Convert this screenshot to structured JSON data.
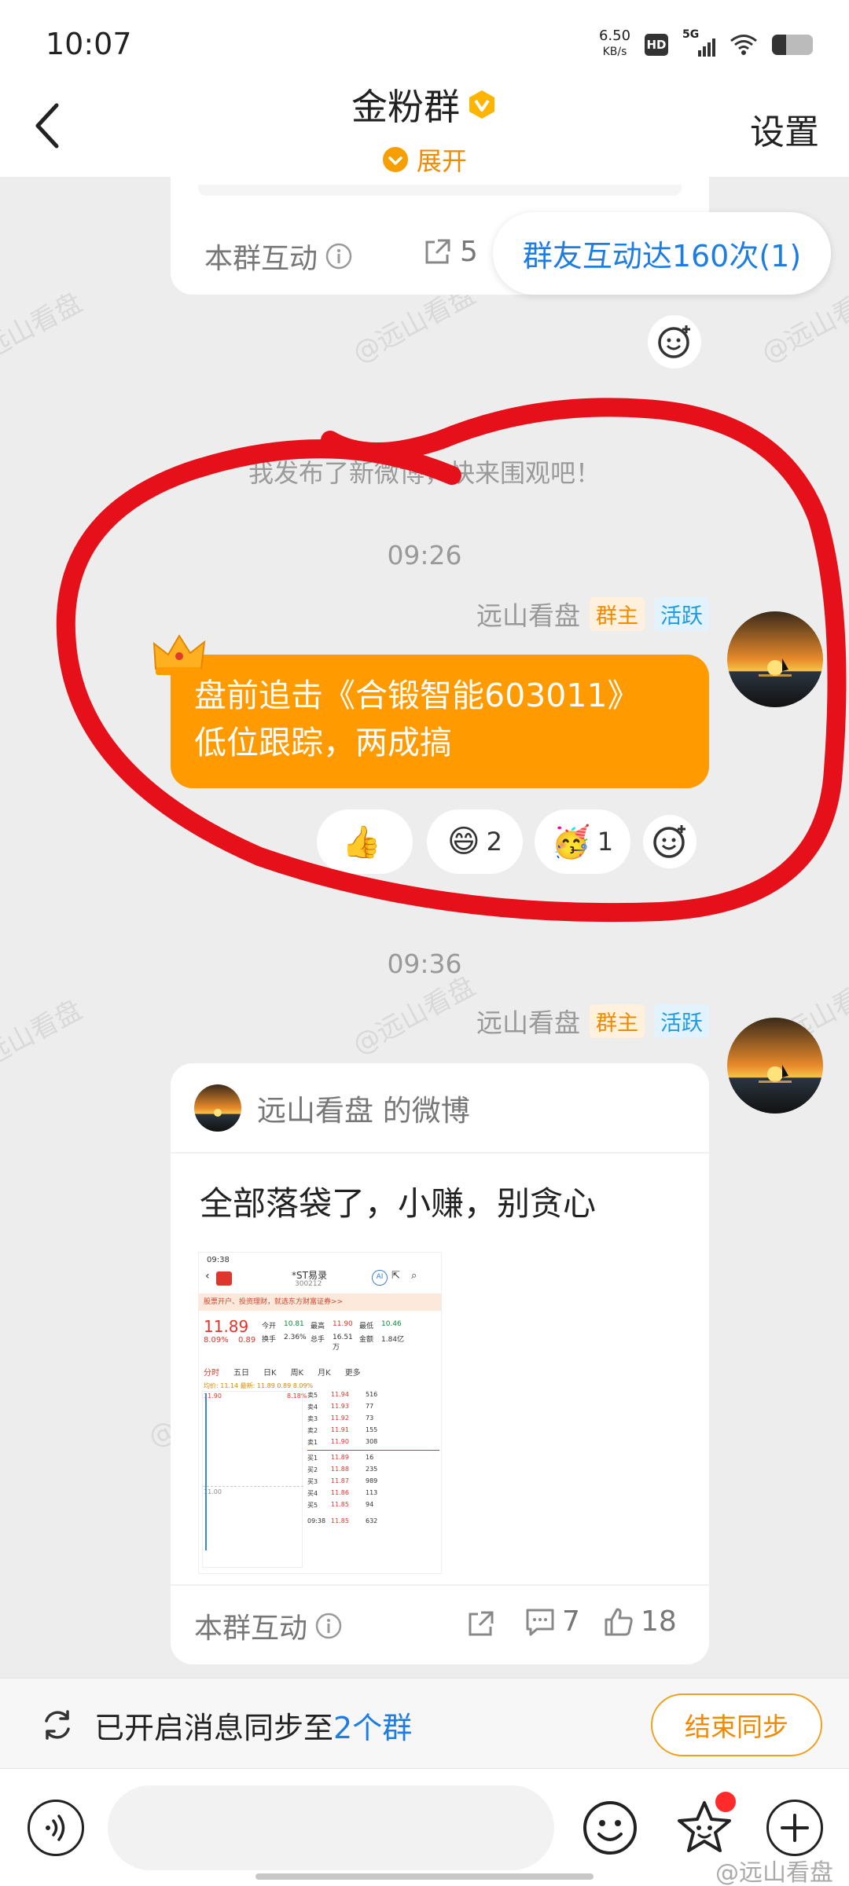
{
  "status_bar": {
    "time": "10:07",
    "net_speed_value": "6.50",
    "net_speed_unit": "KB/s",
    "hd_label": "HD",
    "signal_label": "5G"
  },
  "header": {
    "title": "金粉群",
    "expand_label": "展开",
    "settings_label": "设置"
  },
  "chat": {
    "watermark": "@远山看盘",
    "prev_card": {
      "interact_label": "本群互动",
      "share_count": "5",
      "interact_pill": "群友互动达160次(1)"
    },
    "system_msg": "我发布了新微博，快来围观吧！",
    "messages": [
      {
        "time": "09:26",
        "sender": "远山看盘",
        "tag_owner": "群主",
        "tag_active": "活跃",
        "text_line1": "盘前追击《合锻智能603011》",
        "text_line2": "低位跟踪，两成搞",
        "reactions": [
          {
            "icon": "thumbs-up-emoji",
            "count": ""
          },
          {
            "icon": "smile-emoji",
            "count": "2"
          },
          {
            "icon": "party-emoji",
            "count": "1"
          }
        ]
      },
      {
        "time": "09:36",
        "sender": "远山看盘",
        "tag_owner": "群主",
        "tag_active": "活跃",
        "weibo": {
          "author_line": "远山看盘 的微博",
          "text": "全部落袋了，小赚，别贪心",
          "interact_label": "本群互动",
          "comment_count": "7",
          "like_count": "18",
          "screenshot": {
            "time": "09:38",
            "stock_name": "*ST易录",
            "stock_code": "300212",
            "ad_text": "股票开户、投资理财，就选东方财富证券>>",
            "price": "11.89",
            "change_pct": "8.09%",
            "change_val": "0.89",
            "open_label": "今开",
            "open": "10.81",
            "high_label": "最高",
            "high": "11.90",
            "low_label": "最低",
            "low": "10.46",
            "turnover_label": "换手",
            "turnover": "2.36%",
            "volume_label": "总手",
            "volume": "16.51万",
            "amount_label": "金额",
            "amount": "1.84亿",
            "tabs": [
              "分时",
              "五日",
              "日K",
              "周K",
              "月K",
              "更多"
            ],
            "avg_line": "均价: 11.14 最新: 11.89 0.89 8.09%",
            "chart_top": "11.90",
            "chart_pct": "8.18%",
            "chart_mid": "11.00",
            "sell_rows": [
              [
                "卖5",
                "11.94",
                "516"
              ],
              [
                "卖4",
                "11.93",
                "77"
              ],
              [
                "卖3",
                "11.92",
                "73"
              ],
              [
                "卖2",
                "11.91",
                "155"
              ],
              [
                "卖1",
                "11.90",
                "308"
              ]
            ],
            "buy_rows": [
              [
                "买1",
                "11.89",
                "16"
              ],
              [
                "买2",
                "11.88",
                "235"
              ],
              [
                "买3",
                "11.87",
                "989"
              ],
              [
                "买4",
                "11.86",
                "113"
              ],
              [
                "买5",
                "11.85",
                "94"
              ]
            ],
            "tick_time": "09:38",
            "tick_price": "11.85",
            "tick_vol": "632"
          }
        }
      }
    ]
  },
  "sync_bar": {
    "text_prefix": "已开启消息同步至",
    "text_link": "2个群",
    "end_button": "结束同步"
  },
  "input_bar": {
    "placeholder": ""
  },
  "bottom_watermark": "@远山看盘",
  "colors": {
    "accent_orange": "#ff9a00",
    "link_blue": "#1e7de0",
    "annotation_red": "#e5101a"
  }
}
